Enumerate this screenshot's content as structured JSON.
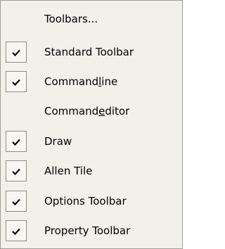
{
  "menu": {
    "items": [
      {
        "label": "Toolbars...",
        "checked": false
      },
      {
        "label": "Standard Toolbar",
        "checked": true
      },
      {
        "label_pre": "Command",
        "label_accel": "l",
        "label_post": "ine",
        "checked": true
      },
      {
        "label_pre": "Command",
        "label_accel": "e",
        "label_post": "ditor",
        "checked": false
      },
      {
        "label": "Draw",
        "checked": true
      },
      {
        "label": "Allen Tile",
        "checked": true
      },
      {
        "label": "Options Toolbar",
        "checked": true
      },
      {
        "label": "Property Toolbar",
        "checked": true
      }
    ],
    "check_icon": "checkmark-icon"
  },
  "colors": {
    "menu_background": "#f1f0e9",
    "menu_border": "#9d9d94",
    "check_box_border": "#8e8e86",
    "check_box_fill": "#f7f6f1",
    "text": "#000000"
  }
}
